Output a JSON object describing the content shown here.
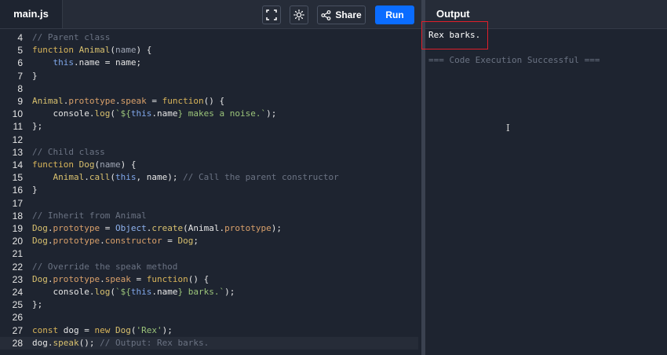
{
  "editor": {
    "file_tab": "main.js",
    "share_label": "Share",
    "run_label": "Run",
    "lines": [
      {
        "n": "4",
        "tokens": [
          [
            "cm",
            "// Parent class"
          ]
        ]
      },
      {
        "n": "5",
        "tokens": [
          [
            "kw",
            "function "
          ],
          [
            "fn",
            "Animal"
          ],
          [
            "plain",
            "("
          ],
          [
            "var",
            "name"
          ],
          [
            "plain",
            ") {"
          ]
        ]
      },
      {
        "n": "6",
        "tokens": [
          [
            "plain",
            "    "
          ],
          [
            "this",
            "this"
          ],
          [
            "plain",
            ".name = name;"
          ]
        ]
      },
      {
        "n": "7",
        "tokens": [
          [
            "plain",
            "}"
          ]
        ]
      },
      {
        "n": "8",
        "tokens": []
      },
      {
        "n": "9",
        "tokens": [
          [
            "fn",
            "Animal"
          ],
          [
            "plain",
            "."
          ],
          [
            "prop",
            "prototype"
          ],
          [
            "plain",
            "."
          ],
          [
            "prop",
            "speak"
          ],
          [
            "plain",
            " = "
          ],
          [
            "kw",
            "function"
          ],
          [
            "plain",
            "() {"
          ]
        ]
      },
      {
        "n": "10",
        "tokens": [
          [
            "plain",
            "    console."
          ],
          [
            "fn",
            "log"
          ],
          [
            "plain",
            "("
          ],
          [
            "str",
            "`${"
          ],
          [
            "this",
            "this"
          ],
          [
            "plain",
            ".name"
          ],
          [
            "str",
            "} makes a noise.`"
          ],
          [
            "plain",
            ");"
          ]
        ]
      },
      {
        "n": "11",
        "tokens": [
          [
            "plain",
            "};"
          ]
        ]
      },
      {
        "n": "12",
        "tokens": []
      },
      {
        "n": "13",
        "tokens": [
          [
            "cm",
            "// Child class"
          ]
        ]
      },
      {
        "n": "14",
        "tokens": [
          [
            "kw",
            "function "
          ],
          [
            "fn",
            "Dog"
          ],
          [
            "plain",
            "("
          ],
          [
            "var",
            "name"
          ],
          [
            "plain",
            ") {"
          ]
        ]
      },
      {
        "n": "15",
        "tokens": [
          [
            "plain",
            "    "
          ],
          [
            "fn",
            "Animal"
          ],
          [
            "plain",
            "."
          ],
          [
            "fn",
            "call"
          ],
          [
            "plain",
            "("
          ],
          [
            "this",
            "this"
          ],
          [
            "plain",
            ", name); "
          ],
          [
            "cm",
            "// Call the parent constructor"
          ]
        ]
      },
      {
        "n": "16",
        "tokens": [
          [
            "plain",
            "}"
          ]
        ]
      },
      {
        "n": "17",
        "tokens": []
      },
      {
        "n": "18",
        "tokens": [
          [
            "cm",
            "// Inherit from Animal"
          ]
        ]
      },
      {
        "n": "19",
        "tokens": [
          [
            "fn",
            "Dog"
          ],
          [
            "plain",
            "."
          ],
          [
            "prop",
            "prototype"
          ],
          [
            "plain",
            " = "
          ],
          [
            "obj",
            "Object"
          ],
          [
            "plain",
            "."
          ],
          [
            "fn",
            "create"
          ],
          [
            "plain",
            "(Animal."
          ],
          [
            "prop",
            "prototype"
          ],
          [
            "plain",
            ");"
          ]
        ]
      },
      {
        "n": "20",
        "tokens": [
          [
            "fn",
            "Dog"
          ],
          [
            "plain",
            "."
          ],
          [
            "prop",
            "prototype"
          ],
          [
            "plain",
            "."
          ],
          [
            "prop",
            "constructor"
          ],
          [
            "plain",
            " = "
          ],
          [
            "fn",
            "Dog"
          ],
          [
            "plain",
            ";"
          ]
        ]
      },
      {
        "n": "21",
        "tokens": []
      },
      {
        "n": "22",
        "tokens": [
          [
            "cm",
            "// Override the speak method"
          ]
        ]
      },
      {
        "n": "23",
        "tokens": [
          [
            "fn",
            "Dog"
          ],
          [
            "plain",
            "."
          ],
          [
            "prop",
            "prototype"
          ],
          [
            "plain",
            "."
          ],
          [
            "prop",
            "speak"
          ],
          [
            "plain",
            " = "
          ],
          [
            "kw",
            "function"
          ],
          [
            "plain",
            "() {"
          ]
        ]
      },
      {
        "n": "24",
        "tokens": [
          [
            "plain",
            "    console."
          ],
          [
            "fn",
            "log"
          ],
          [
            "plain",
            "("
          ],
          [
            "str",
            "`${"
          ],
          [
            "this",
            "this"
          ],
          [
            "plain",
            ".name"
          ],
          [
            "str",
            "} barks.`"
          ],
          [
            "plain",
            ");"
          ]
        ]
      },
      {
        "n": "25",
        "tokens": [
          [
            "plain",
            "};"
          ]
        ]
      },
      {
        "n": "26",
        "tokens": []
      },
      {
        "n": "27",
        "tokens": [
          [
            "kw",
            "const "
          ],
          [
            "plain",
            "dog = "
          ],
          [
            "kw",
            "new "
          ],
          [
            "fn",
            "Dog"
          ],
          [
            "plain",
            "("
          ],
          [
            "str",
            "'Rex'"
          ],
          [
            "plain",
            ");"
          ]
        ]
      },
      {
        "n": "28",
        "tokens": [
          [
            "plain",
            "dog."
          ],
          [
            "fn",
            "speak"
          ],
          [
            "plain",
            "(); "
          ],
          [
            "cm",
            "// Output: Rex barks."
          ]
        ]
      }
    ],
    "active_line": "28"
  },
  "output": {
    "title": "Output",
    "result": "Rex barks.",
    "status": "=== Code Execution Successful ==="
  },
  "icons": {
    "fullscreen": "fullscreen-icon",
    "theme": "sun-icon",
    "share": "share-icon"
  },
  "colors": {
    "run_button": "#0a6cff",
    "highlight": "#e01f2a"
  }
}
